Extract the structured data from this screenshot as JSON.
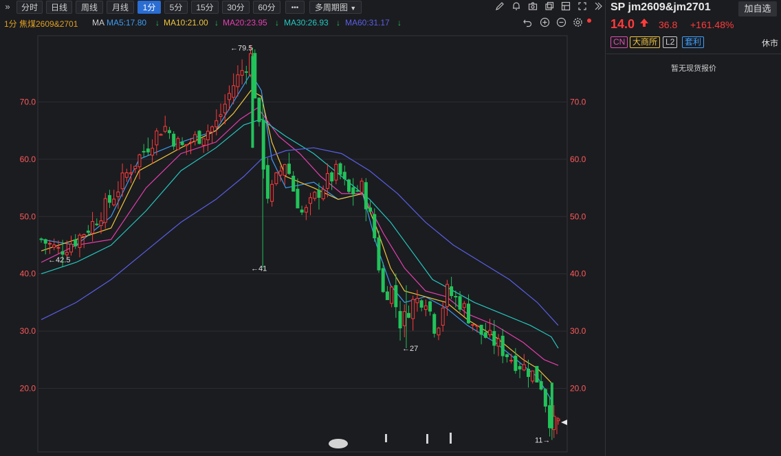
{
  "toolbar": {
    "collapse_glyph": "»",
    "periods": [
      "分时",
      "日线",
      "周线",
      "月线",
      "1分",
      "5分",
      "15分",
      "30分",
      "60分"
    ],
    "active_period": "1分",
    "more": "•••",
    "multi_period": "多周期图",
    "icons": [
      "draw-icon",
      "bell-icon",
      "camera-icon",
      "window-icon",
      "layout-icon",
      "fullscreen-icon",
      "expand-icon"
    ]
  },
  "ma_row": {
    "prefix": "1分 焦煤2609&2701",
    "ma_label": "MA",
    "items": [
      {
        "text": "MA5:17.80",
        "color": "#3d9cf2"
      },
      {
        "text": "MA10:21.00",
        "color": "#f0c53c"
      },
      {
        "text": "MA20:23.95",
        "color": "#e63fb0"
      },
      {
        "text": "MA30:26.93",
        "color": "#24c8c0"
      },
      {
        "text": "MA60:31.17",
        "color": "#5a5fe6"
      }
    ],
    "arrow_glyph": "↓",
    "right_icons": [
      "undo-icon",
      "zoom-in-icon",
      "zoom-out-icon",
      "settings-icon"
    ]
  },
  "chart_data": {
    "type": "candlestick",
    "ylim": [
      10,
      83
    ],
    "yticks": [
      "70.0",
      "60.0",
      "50.0",
      "40.0",
      "30.0",
      "20.0"
    ],
    "annotations": [
      {
        "text": "←79.5",
        "value": 79.5,
        "kind": "high"
      },
      {
        "text": "←42.5",
        "value": 42.5,
        "kind": "low"
      },
      {
        "text": "←41",
        "value": 41,
        "kind": "low"
      },
      {
        "text": "←27",
        "value": 27,
        "kind": "low"
      },
      {
        "text": "11→",
        "value": 11,
        "kind": "low"
      }
    ],
    "colors": {
      "up": "#ff3b3b",
      "down": "#22c35a",
      "grid": "#2c2d33",
      "axis": "#ff5a5a"
    },
    "candle_count": 122,
    "close_anchors": [
      [
        0,
        46
      ],
      [
        5,
        44
      ],
      [
        10,
        46
      ],
      [
        15,
        49
      ],
      [
        20,
        53
      ],
      [
        25,
        58
      ],
      [
        30,
        62
      ],
      [
        35,
        66
      ],
      [
        40,
        62
      ],
      [
        45,
        64
      ],
      [
        50,
        66
      ],
      [
        55,
        73
      ],
      [
        60,
        78
      ],
      [
        62,
        67
      ],
      [
        63,
        62
      ],
      [
        65,
        53
      ],
      [
        67,
        56
      ],
      [
        70,
        60
      ],
      [
        72,
        55
      ],
      [
        75,
        50
      ],
      [
        80,
        55
      ],
      [
        85,
        58
      ],
      [
        88,
        54
      ],
      [
        92,
        55
      ],
      [
        95,
        48
      ],
      [
        98,
        36
      ],
      [
        100,
        38
      ],
      [
        103,
        31
      ],
      [
        106,
        35
      ],
      [
        110,
        36
      ],
      [
        113,
        30
      ],
      [
        116,
        37
      ],
      [
        120,
        35
      ],
      [
        125,
        30
      ],
      [
        130,
        28
      ],
      [
        135,
        25
      ],
      [
        140,
        23
      ],
      [
        143,
        21
      ],
      [
        146,
        13.5
      ],
      [
        148,
        14
      ]
    ],
    "ma": [
      {
        "name": "MA5",
        "color": "#3d9cf2",
        "points": [
          [
            0,
            46
          ],
          [
            10,
            45
          ],
          [
            20,
            50
          ],
          [
            28,
            60
          ],
          [
            40,
            63
          ],
          [
            50,
            65
          ],
          [
            55,
            70
          ],
          [
            60,
            75
          ],
          [
            63,
            72
          ],
          [
            66,
            60
          ],
          [
            70,
            55
          ],
          [
            78,
            56
          ],
          [
            85,
            53
          ],
          [
            92,
            54
          ],
          [
            96,
            45
          ],
          [
            100,
            38
          ],
          [
            104,
            35
          ],
          [
            110,
            36
          ],
          [
            116,
            34
          ],
          [
            122,
            31
          ],
          [
            130,
            28
          ],
          [
            138,
            24
          ],
          [
            142,
            22
          ],
          [
            146,
            18
          ]
        ]
      },
      {
        "name": "MA10",
        "color": "#f0c53c",
        "points": [
          [
            0,
            44
          ],
          [
            10,
            46
          ],
          [
            20,
            48
          ],
          [
            28,
            58
          ],
          [
            40,
            62
          ],
          [
            50,
            65
          ],
          [
            55,
            68
          ],
          [
            60,
            72
          ],
          [
            63,
            71
          ],
          [
            66,
            63
          ],
          [
            70,
            57
          ],
          [
            78,
            55
          ],
          [
            85,
            53
          ],
          [
            92,
            54
          ],
          [
            96,
            48
          ],
          [
            100,
            41
          ],
          [
            104,
            37
          ],
          [
            110,
            36
          ],
          [
            116,
            35
          ],
          [
            122,
            32
          ],
          [
            130,
            29
          ],
          [
            138,
            25
          ],
          [
            142,
            23.5
          ],
          [
            146,
            21
          ]
        ]
      },
      {
        "name": "MA20",
        "color": "#e63fb0",
        "points": [
          [
            0,
            42
          ],
          [
            10,
            45
          ],
          [
            20,
            46
          ],
          [
            30,
            55
          ],
          [
            40,
            61
          ],
          [
            50,
            63
          ],
          [
            57,
            67
          ],
          [
            62,
            69
          ],
          [
            68,
            64
          ],
          [
            74,
            61
          ],
          [
            80,
            57
          ],
          [
            86,
            54
          ],
          [
            92,
            54
          ],
          [
            98,
            47
          ],
          [
            104,
            41
          ],
          [
            110,
            37
          ],
          [
            116,
            36
          ],
          [
            122,
            33
          ],
          [
            130,
            31
          ],
          [
            138,
            28
          ],
          [
            144,
            25
          ],
          [
            148,
            24
          ]
        ]
      },
      {
        "name": "MA30",
        "color": "#24c8c0",
        "points": [
          [
            0,
            40
          ],
          [
            10,
            42
          ],
          [
            20,
            45
          ],
          [
            30,
            51
          ],
          [
            40,
            58
          ],
          [
            50,
            62
          ],
          [
            58,
            66
          ],
          [
            63,
            67
          ],
          [
            70,
            64
          ],
          [
            78,
            61
          ],
          [
            86,
            57
          ],
          [
            94,
            53
          ],
          [
            100,
            49
          ],
          [
            106,
            44
          ],
          [
            112,
            39
          ],
          [
            118,
            37
          ],
          [
            124,
            35
          ],
          [
            132,
            33
          ],
          [
            140,
            31
          ],
          [
            146,
            29
          ],
          [
            148,
            27
          ]
        ]
      },
      {
        "name": "MA60",
        "color": "#5a5fe6",
        "points": [
          [
            0,
            32
          ],
          [
            10,
            35
          ],
          [
            20,
            39
          ],
          [
            30,
            44
          ],
          [
            40,
            49
          ],
          [
            50,
            53
          ],
          [
            58,
            57
          ],
          [
            63,
            60
          ],
          [
            70,
            61.5
          ],
          [
            78,
            62
          ],
          [
            86,
            61
          ],
          [
            94,
            58
          ],
          [
            102,
            54
          ],
          [
            110,
            49
          ],
          [
            118,
            45
          ],
          [
            126,
            42
          ],
          [
            134,
            39
          ],
          [
            142,
            35
          ],
          [
            148,
            31
          ]
        ]
      }
    ]
  },
  "quote": {
    "title": "SP jm2609&jm2701",
    "add_fav": "加自选",
    "price": "14.0",
    "arrow": "🡅",
    "change": "36.8",
    "change_pct": "+161.48%",
    "tags": [
      {
        "text": "CN",
        "color": "#e24fb0"
      },
      {
        "text": "大商所",
        "color": "#f0c53c"
      },
      {
        "text": "L2",
        "color": "#cfcfcf"
      },
      {
        "text": "套利",
        "color": "#3da0ff"
      }
    ],
    "status": "休市",
    "no_spot": "暂无现货报价"
  }
}
